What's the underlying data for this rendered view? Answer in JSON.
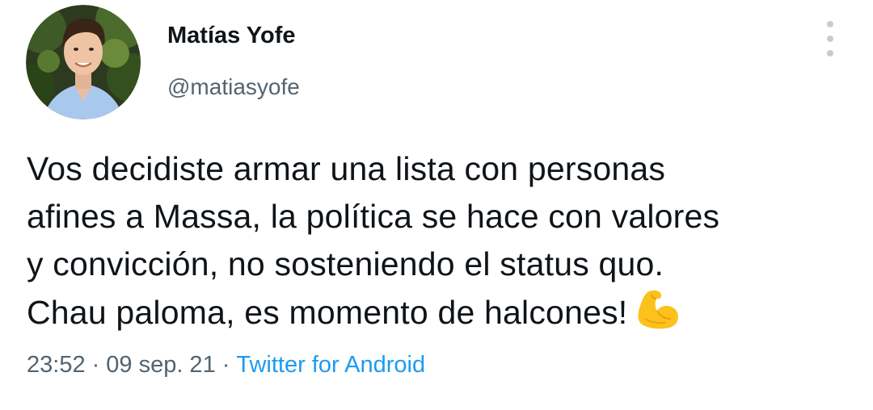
{
  "user": {
    "display_name": "Matías Yofe",
    "handle": "@matiasyofe",
    "avatar": "profile-photo"
  },
  "tweet": {
    "lines": [
      "Vos decidiste armar una lista con personas",
      "afines a Massa, la política se hace con valores",
      "y convicción, no sosteniendo el status quo.",
      "Chau paloma, es momento de halcones!"
    ],
    "emoji": "flexed-biceps-icon"
  },
  "meta": {
    "time": "23:52",
    "date": "09 sep. 21",
    "separator": "·",
    "source": "Twitter for Android"
  },
  "menu": {
    "icon": "vertical-dots-icon"
  },
  "colors": {
    "text_primary": "#0f1419",
    "text_secondary": "#536471",
    "link": "#1d9bf0",
    "emoji_yellow": "#fcc21b"
  }
}
